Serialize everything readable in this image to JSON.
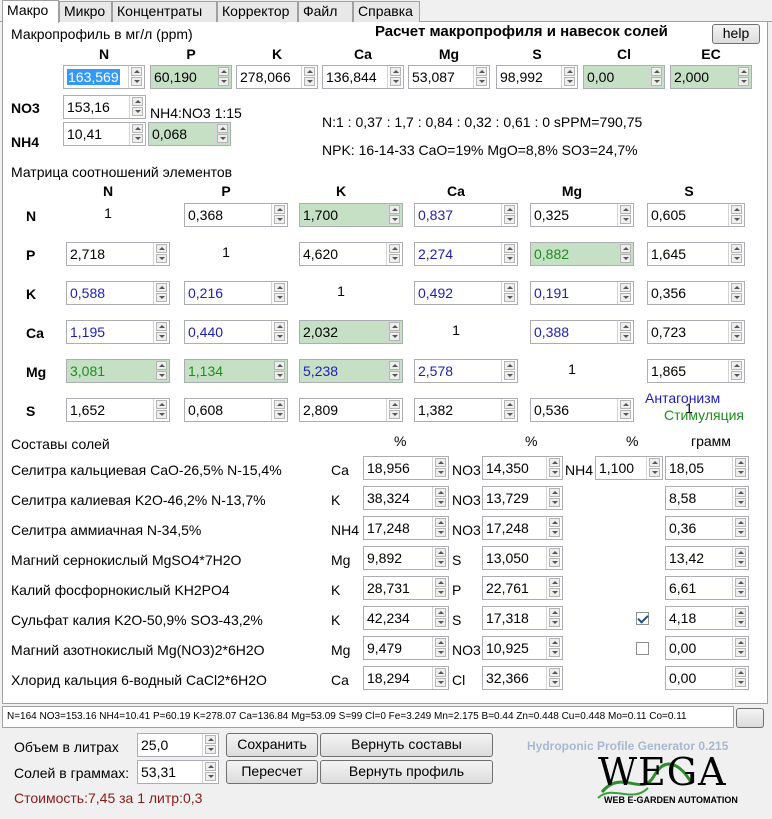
{
  "tabs": [
    "Макро",
    "Микро",
    "Концентраты",
    "Корректор",
    "Файл",
    "Справка"
  ],
  "macro": {
    "heading": "Макропрофиль в мг/л (ppm)",
    "title": "Расчет макропрофиля и навесок солей",
    "help": "help",
    "headers": [
      "N",
      "P",
      "K",
      "Ca",
      "Mg",
      "S",
      "Cl",
      "EC"
    ],
    "values": [
      "163,569",
      "60,190",
      "278,066",
      "136,844",
      "53,087",
      "98,992",
      "0,00",
      "2,000"
    ],
    "no3_label": "NO3",
    "no3": "153,16",
    "ratio": "NH4:NO3 1:15",
    "nh4_label": "NH4",
    "nh4": "10,41",
    "nh4_ratio": "0,068",
    "npk_line": "N:1 : 0,37 : 1,7 : 0,84 : 0,32 : 0,61 : 0 sPPM=790,75",
    "npk_line2": "NPK: 16-14-33 CaO=19% MgO=8,8% SO3=24,7%"
  },
  "matrix": {
    "title": "Матрица соотношений элементов",
    "cols": [
      "N",
      "P",
      "K",
      "Ca",
      "Mg",
      "S"
    ],
    "rows": [
      {
        "label": "N",
        "cells": [
          "1",
          "0,368",
          "1,700",
          "0,837",
          "0,325",
          "0,605"
        ]
      },
      {
        "label": "P",
        "cells": [
          "2,718",
          "1",
          "4,620",
          "2,274",
          "0,882",
          "1,645"
        ]
      },
      {
        "label": "K",
        "cells": [
          "0,588",
          "0,216",
          "1",
          "0,492",
          "0,191",
          "0,356"
        ]
      },
      {
        "label": "Ca",
        "cells": [
          "1,195",
          "0,440",
          "2,032",
          "1",
          "0,388",
          "0,723"
        ]
      },
      {
        "label": "Mg",
        "cells": [
          "3,081",
          "1,134",
          "5,238",
          "2,578",
          "1",
          "1,865"
        ]
      },
      {
        "label": "S",
        "cells": [
          "1,652",
          "0,608",
          "2,809",
          "1,382",
          "0,536",
          "1"
        ]
      }
    ],
    "antagonism": "Антагонизм",
    "stimulation": "Стимуляция",
    "colors": {
      "antagonism": "#1e1eb4",
      "stimulation": "#1e8c1e",
      "highlight": "#c6e0c6"
    }
  },
  "salts": {
    "title": "Составы солей",
    "pct": "%",
    "gram": "грамм",
    "rows": [
      {
        "name": "Селитра кальциевая CaO-26,5% N-15,4%",
        "e1": "Ca",
        "v1": "18,956",
        "e2": "NO3",
        "v2": "14,350",
        "e3": "NH4",
        "v3": "1,100",
        "g": "18,05"
      },
      {
        "name": "Селитра калиевая K2O-46,2% N-13,7%",
        "e1": "K",
        "v1": "38,324",
        "e2": "NO3",
        "v2": "13,729",
        "g": "8,58"
      },
      {
        "name": "Селитра аммиачная N-34,5%",
        "e1": "NH4",
        "v1": "17,248",
        "e2": "NO3",
        "v2": "17,248",
        "g": "0,36"
      },
      {
        "name": "Магний сернокислый MgSO4*7H2O",
        "e1": "Mg",
        "v1": "9,892",
        "e2": "S",
        "v2": "13,050",
        "g": "13,42"
      },
      {
        "name": "Калий фосфорнокислый KH2PO4",
        "e1": "K",
        "v1": "28,731",
        "e2": "P",
        "v2": "22,761",
        "g": "6,61"
      },
      {
        "name": "Сульфат калия K2O-50,9% SO3-43,2%",
        "e1": "K",
        "v1": "42,234",
        "e2": "S",
        "v2": "17,318",
        "chk": true,
        "g": "4,18"
      },
      {
        "name": "Магний азотнокислый Mg(NO3)2*6H2O",
        "e1": "Mg",
        "v1": "9,479",
        "e2": "NO3",
        "v2": "10,925",
        "chk": false,
        "g": "0,00"
      },
      {
        "name": "Хлорид кальция 6-водный CaCl2*6H2O",
        "e1": "Ca",
        "v1": "18,294",
        "e2": "Cl",
        "v2": "32,366",
        "g": "0,00"
      }
    ]
  },
  "status": "N=164 NO3=153.16 NH4=10.41 P=60.19 K=278.07 Ca=136.84 Mg=53.09 S=99 Cl=0 Fe=3.249 Mn=2.175 B=0.44 Zn=0.448 Cu=0.448 Mo=0.11 Co=0.11",
  "bottom": {
    "volume_label": "Объем в литрах",
    "volume": "25,0",
    "salts_label": "Солей в граммах:",
    "salts": "53,31",
    "save": "Сохранить",
    "recalc": "Пересчет",
    "restore_salts": "Вернуть составы",
    "restore_profile": "Вернуть профиль",
    "cost": "Стоимость:7,45 за 1 литр:0,3",
    "app_name": "Hydroponic Profile Generator 0.215",
    "logo": "WEGA",
    "logo_sub": "WEB E-GARDEN AUTOMATION"
  }
}
